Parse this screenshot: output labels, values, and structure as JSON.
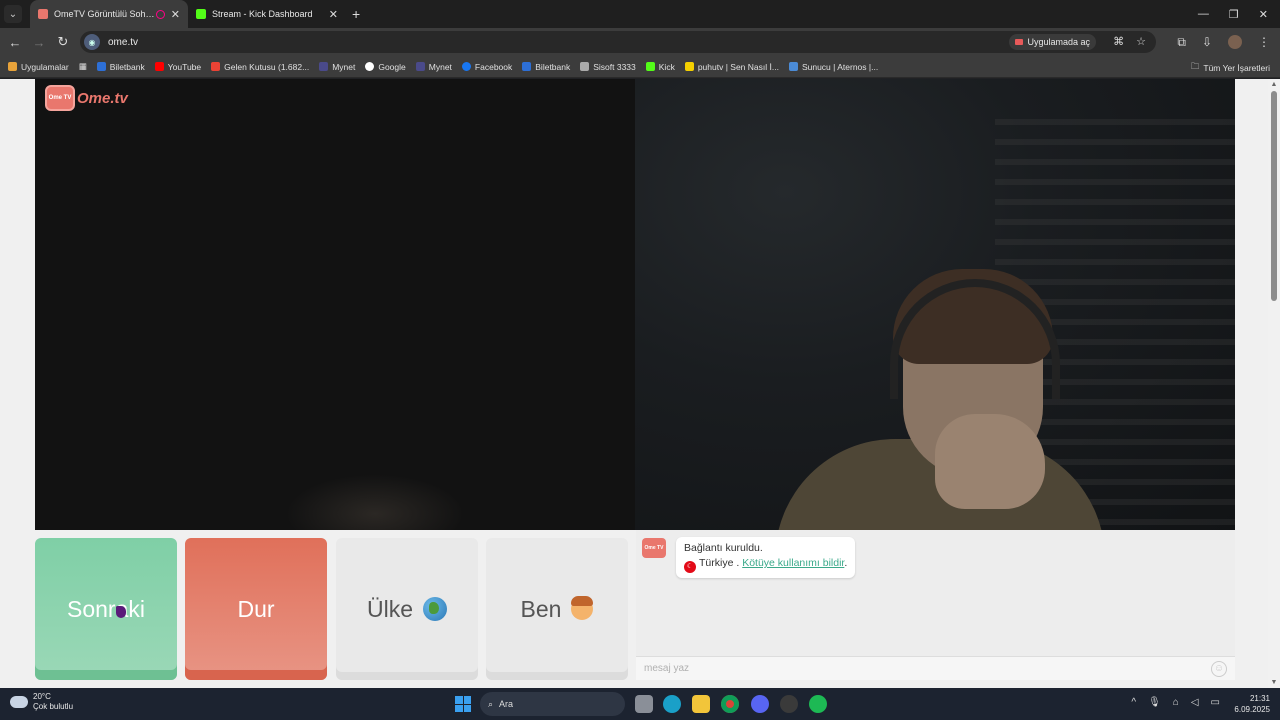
{
  "tabs": [
    {
      "title": "OmeTV Görüntülü Sohbet",
      "favicon_color": "#e9776d",
      "active": true
    },
    {
      "title": "Stream - Kick Dashboard",
      "favicon_color": "#53fc18",
      "active": false
    }
  ],
  "toolbar": {
    "url": "ome.tv",
    "open_in_app": "Uygulamada aç"
  },
  "bookmarks": [
    {
      "label": "Uygulamalar",
      "color": "#e8a33a"
    },
    {
      "label": "Biletbank",
      "color": "#2d6fd6"
    },
    {
      "label": "YouTube",
      "color": "#ff0000"
    },
    {
      "label": "Gelen Kutusu (1.682...",
      "color": "#ea4335"
    },
    {
      "label": "Mynet",
      "color": "#4a4a8a"
    },
    {
      "label": "Google",
      "color": "#ffffff"
    },
    {
      "label": "Mynet",
      "color": "#4a4a8a"
    },
    {
      "label": "Facebook",
      "color": "#1877f2"
    },
    {
      "label": "Biletbank",
      "color": "#2d6fd6"
    },
    {
      "label": "Sisoft 3333",
      "color": "#aaaaaa"
    },
    {
      "label": "Kick",
      "color": "#53fc18"
    },
    {
      "label": "puhutv | Sen Nasıl İ...",
      "color": "#f5d000"
    },
    {
      "label": "Sunucu | Aternos |...",
      "color": "#4b8bd6"
    }
  ],
  "bookmarks_all": "Tüm Yer İşaretleri",
  "logo": {
    "badge": "Ome TV",
    "brand": "Ome.tv"
  },
  "controls": {
    "next": "Sonraki",
    "stop": "Dur",
    "country": "Ülke",
    "me": "Ben"
  },
  "chat": {
    "logo_badge": "Ome TV",
    "status": "Bağlantı kuruldu.",
    "country": "Türkiye",
    "separator": " . ",
    "report": "Kötüye kullanımı bildir",
    "report_suffix": ".",
    "placeholder": "mesaj yaz"
  },
  "taskbar": {
    "temperature": "20°C",
    "weather": "Çok bulutlu",
    "search": "Ara",
    "time": "21:31",
    "date": "6.09.2025"
  },
  "colors": {
    "next": "#7fcfa6",
    "stop": "#e0705a",
    "brand": "#e9776d"
  }
}
